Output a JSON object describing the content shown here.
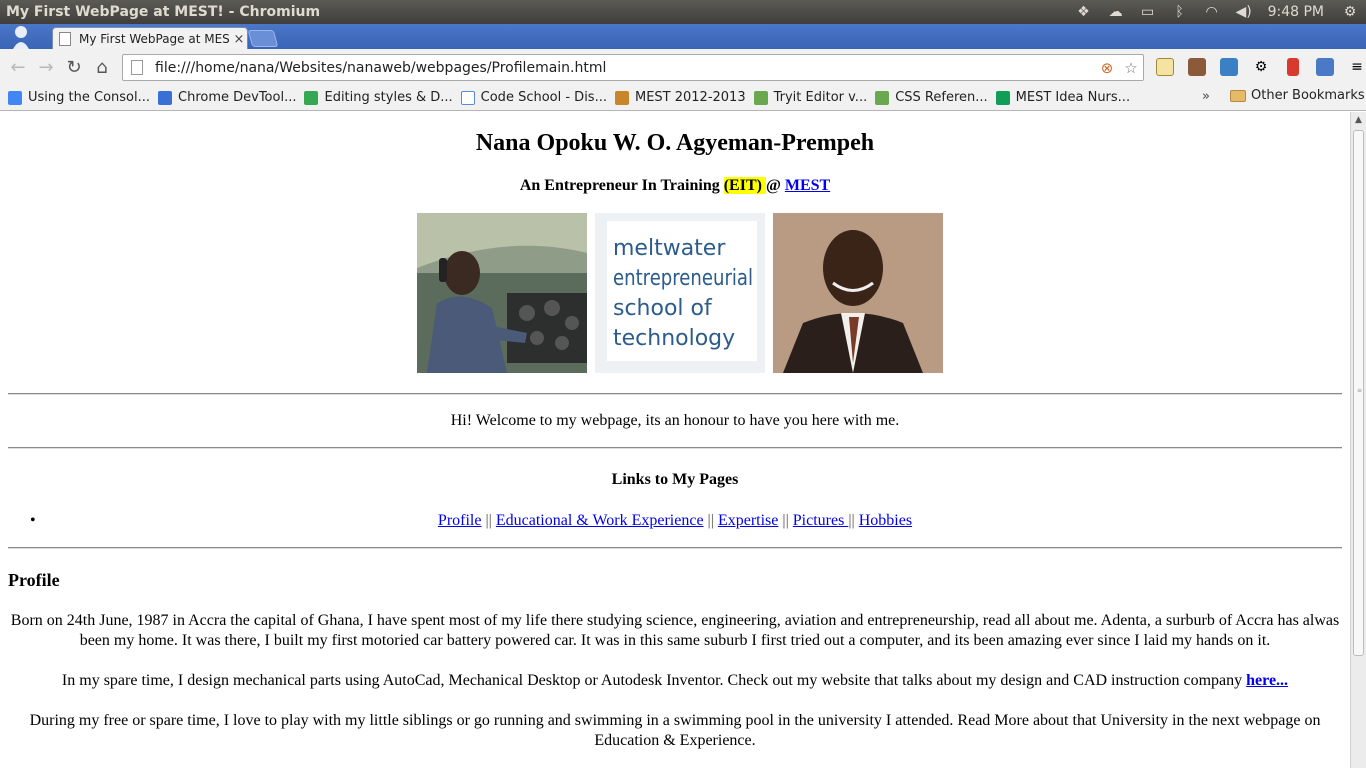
{
  "window": {
    "title": "My First WebPage at MEST! - Chromium"
  },
  "tray": {
    "time": "9:48 PM"
  },
  "tab": {
    "title": "My First WebPage at MES",
    "close": "×"
  },
  "omnibox": {
    "url": "file:///home/nana/Websites/nanaweb/webpages/Profilemain.html"
  },
  "bookmarks": {
    "items": [
      {
        "label": "Using the Consol...",
        "color": "#4285f4"
      },
      {
        "label": "Chrome DevTool...",
        "color": "#3a6fd6"
      },
      {
        "label": "Editing styles & D...",
        "color": "#34a853"
      },
      {
        "label": "Code School - Dis...",
        "color": "#5c8ad6"
      },
      {
        "label": "MEST 2012-2013",
        "color": "#c8862a"
      },
      {
        "label": "Tryit Editor v...",
        "color": "#6aa84f"
      },
      {
        "label": "CSS Referen...",
        "color": "#6aa84f"
      },
      {
        "label": "MEST Idea Nurs...",
        "color": "#0f9d58"
      }
    ],
    "more": "»",
    "other": "Other Bookmarks"
  },
  "page": {
    "name": "Nana Opoku W. O. Agyeman-Prempeh",
    "tagline_prefix": "An Entrepreneur In Training ",
    "tagline_highlight": "(EIT) ",
    "tagline_at": "@ ",
    "tagline_link": "MEST",
    "logo_text": [
      "meltwater",
      "entrepreneurial",
      "school of",
      "technology"
    ],
    "welcome": "Hi! Welcome to my webpage, its an honour to have you here with me.",
    "links_title": "Links to My Pages",
    "links": [
      "Profile",
      "Educational & Work Experience",
      "Expertise",
      "Pictures ",
      "Hobbies"
    ],
    "separator": "||",
    "profile_heading": "Profile",
    "para1": "Born on 24th June, 1987 in Accra the capital of Ghana, I have spent most of my life there studying science, engineering, aviation and entrepreneurship, read all about me. Adenta, a surburb of Accra has alwas been my home. It was there, I built my first motoried car battery powered car. It was in this same suburb I first tried out a computer, and its been amazing ever since I laid my hands on it.",
    "para2_text": "In my spare time, I design mechanical parts using AutoCad, Mechanical Desktop or Autodesk Inventor. Check out my website that talks about my design and CAD instruction company ",
    "para2_link": "here...",
    "para3": "During my free or spare time, I love to play with my little siblings or go running and swimming in a swimming pool in the university I attended. Read More about that University in the next webpage on Education & Experience."
  }
}
